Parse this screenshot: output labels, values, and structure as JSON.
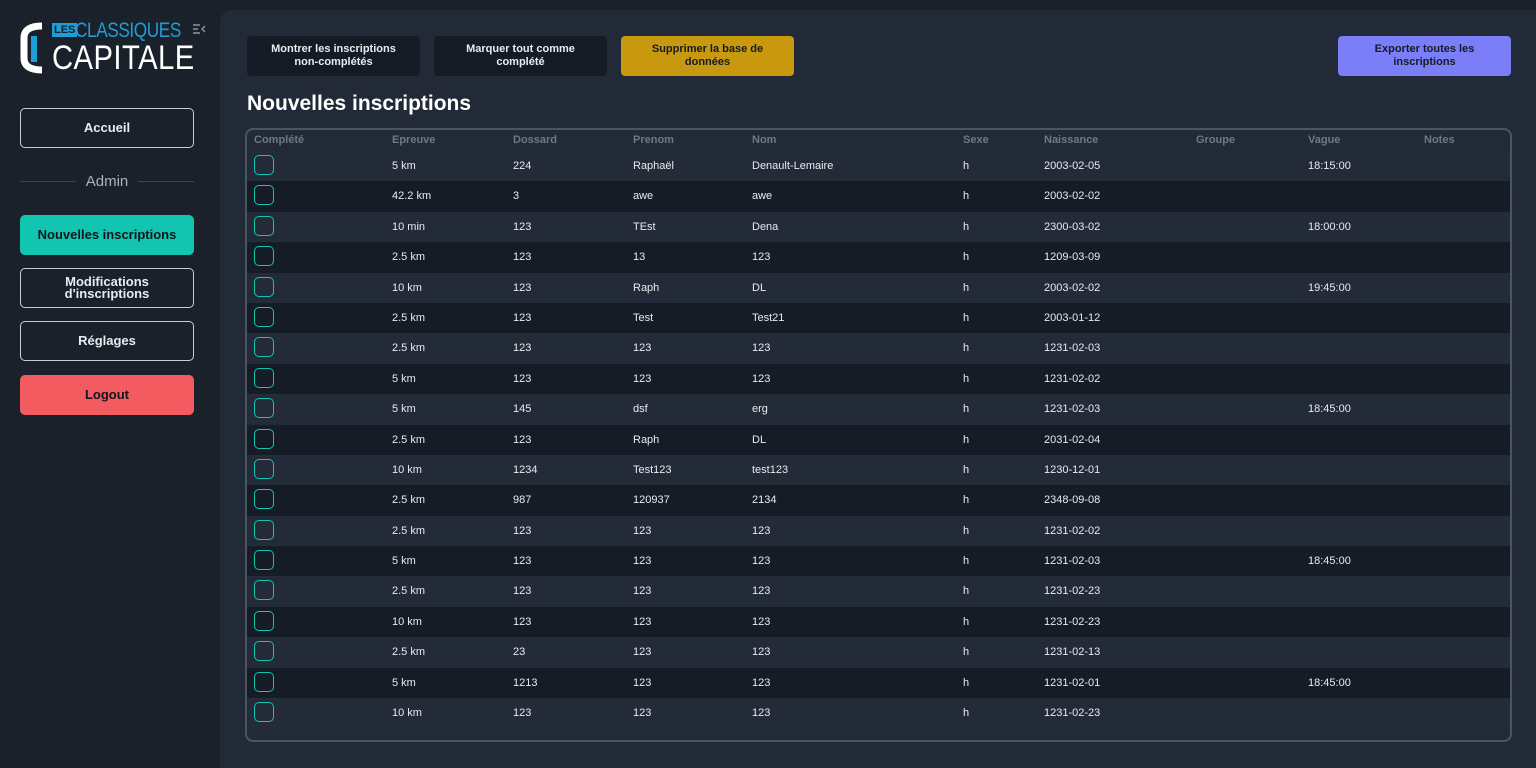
{
  "logo": {
    "les": "LES",
    "classiques": "CLASSIQUES",
    "capitale": "CAPITALE"
  },
  "sidebar": {
    "accueil": "Accueil",
    "section": "Admin",
    "items": [
      {
        "label": "Nouvelles inscriptions",
        "active": true
      },
      {
        "label": "Modifications d'inscriptions"
      },
      {
        "label": "Réglages"
      }
    ],
    "logout": "Logout"
  },
  "toolbar": {
    "show_incomplete": "Montrer les inscriptions non-complétés",
    "mark_all": "Marquer tout comme complété",
    "delete_db": "Supprimer la base de données",
    "export_all": "Exporter toutes les inscriptions"
  },
  "page": {
    "title": "Nouvelles inscriptions"
  },
  "colors": {
    "accent_teal": "#12c5b0",
    "gold": "#c8980f",
    "purple": "#7b7ef7",
    "logout_red": "#f45b61",
    "brand_blue": "#1d9ed8"
  },
  "table": {
    "columns": [
      "Complété",
      "Epreuve",
      "Dossard",
      "Prenom",
      "Nom",
      "Sexe",
      "Naissance",
      "Groupe",
      "Vague",
      "Notes"
    ],
    "rows": [
      {
        "epreuve": "5 km",
        "dossard": "224",
        "prenom": "Raphaël",
        "nom": "Denault-Lemaire",
        "sexe": "h",
        "naissance": "2003-02-05",
        "groupe": "",
        "vague": "18:15:00",
        "notes": ""
      },
      {
        "epreuve": "42.2 km",
        "dossard": "3",
        "prenom": "awe",
        "nom": "awe",
        "sexe": "h",
        "naissance": "2003-02-02",
        "groupe": "",
        "vague": "",
        "notes": ""
      },
      {
        "epreuve": "10 min",
        "dossard": "123",
        "prenom": "TEst",
        "nom": "Dena",
        "sexe": "h",
        "naissance": "2300-03-02",
        "groupe": "",
        "vague": "18:00:00",
        "notes": ""
      },
      {
        "epreuve": "2.5 km",
        "dossard": "123",
        "prenom": "13",
        "nom": "123",
        "sexe": "h",
        "naissance": "1209-03-09",
        "groupe": "",
        "vague": "",
        "notes": ""
      },
      {
        "epreuve": "10 km",
        "dossard": "123",
        "prenom": "Raph",
        "nom": "DL",
        "sexe": "h",
        "naissance": "2003-02-02",
        "groupe": "",
        "vague": "19:45:00",
        "notes": ""
      },
      {
        "epreuve": "2.5 km",
        "dossard": "123",
        "prenom": "Test",
        "nom": "Test21",
        "sexe": "h",
        "naissance": "2003-01-12",
        "groupe": "",
        "vague": "",
        "notes": ""
      },
      {
        "epreuve": "2.5 km",
        "dossard": "123",
        "prenom": "123",
        "nom": "123",
        "sexe": "h",
        "naissance": "1231-02-03",
        "groupe": "",
        "vague": "",
        "notes": ""
      },
      {
        "epreuve": "5 km",
        "dossard": "123",
        "prenom": "123",
        "nom": "123",
        "sexe": "h",
        "naissance": "1231-02-02",
        "groupe": "",
        "vague": "",
        "notes": ""
      },
      {
        "epreuve": "5 km",
        "dossard": "145",
        "prenom": "dsf",
        "nom": "erg",
        "sexe": "h",
        "naissance": "1231-02-03",
        "groupe": "",
        "vague": "18:45:00",
        "notes": ""
      },
      {
        "epreuve": "2.5 km",
        "dossard": "123",
        "prenom": "Raph",
        "nom": "DL",
        "sexe": "h",
        "naissance": "2031-02-04",
        "groupe": "",
        "vague": "",
        "notes": ""
      },
      {
        "epreuve": "10 km",
        "dossard": "1234",
        "prenom": "Test123",
        "nom": "test123",
        "sexe": "h",
        "naissance": "1230-12-01",
        "groupe": "",
        "vague": "",
        "notes": ""
      },
      {
        "epreuve": "2.5 km",
        "dossard": "987",
        "prenom": "120937",
        "nom": "2134",
        "sexe": "h",
        "naissance": "2348-09-08",
        "groupe": "",
        "vague": "",
        "notes": ""
      },
      {
        "epreuve": "2.5 km",
        "dossard": "123",
        "prenom": "123",
        "nom": "123",
        "sexe": "h",
        "naissance": "1231-02-02",
        "groupe": "",
        "vague": "",
        "notes": ""
      },
      {
        "epreuve": "5 km",
        "dossard": "123",
        "prenom": "123",
        "nom": "123",
        "sexe": "h",
        "naissance": "1231-02-03",
        "groupe": "",
        "vague": "18:45:00",
        "notes": ""
      },
      {
        "epreuve": "2.5 km",
        "dossard": "123",
        "prenom": "123",
        "nom": "123",
        "sexe": "h",
        "naissance": "1231-02-23",
        "groupe": "",
        "vague": "",
        "notes": ""
      },
      {
        "epreuve": "10 km",
        "dossard": "123",
        "prenom": "123",
        "nom": "123",
        "sexe": "h",
        "naissance": "1231-02-23",
        "groupe": "",
        "vague": "",
        "notes": ""
      },
      {
        "epreuve": "2.5 km",
        "dossard": "23",
        "prenom": "123",
        "nom": "123",
        "sexe": "h",
        "naissance": "1231-02-13",
        "groupe": "",
        "vague": "",
        "notes": ""
      },
      {
        "epreuve": "5 km",
        "dossard": "1213",
        "prenom": "123",
        "nom": "123",
        "sexe": "h",
        "naissance": "1231-02-01",
        "groupe": "",
        "vague": "18:45:00",
        "notes": ""
      },
      {
        "epreuve": "10 km",
        "dossard": "123",
        "prenom": "123",
        "nom": "123",
        "sexe": "h",
        "naissance": "1231-02-23",
        "groupe": "",
        "vague": "",
        "notes": ""
      }
    ]
  }
}
